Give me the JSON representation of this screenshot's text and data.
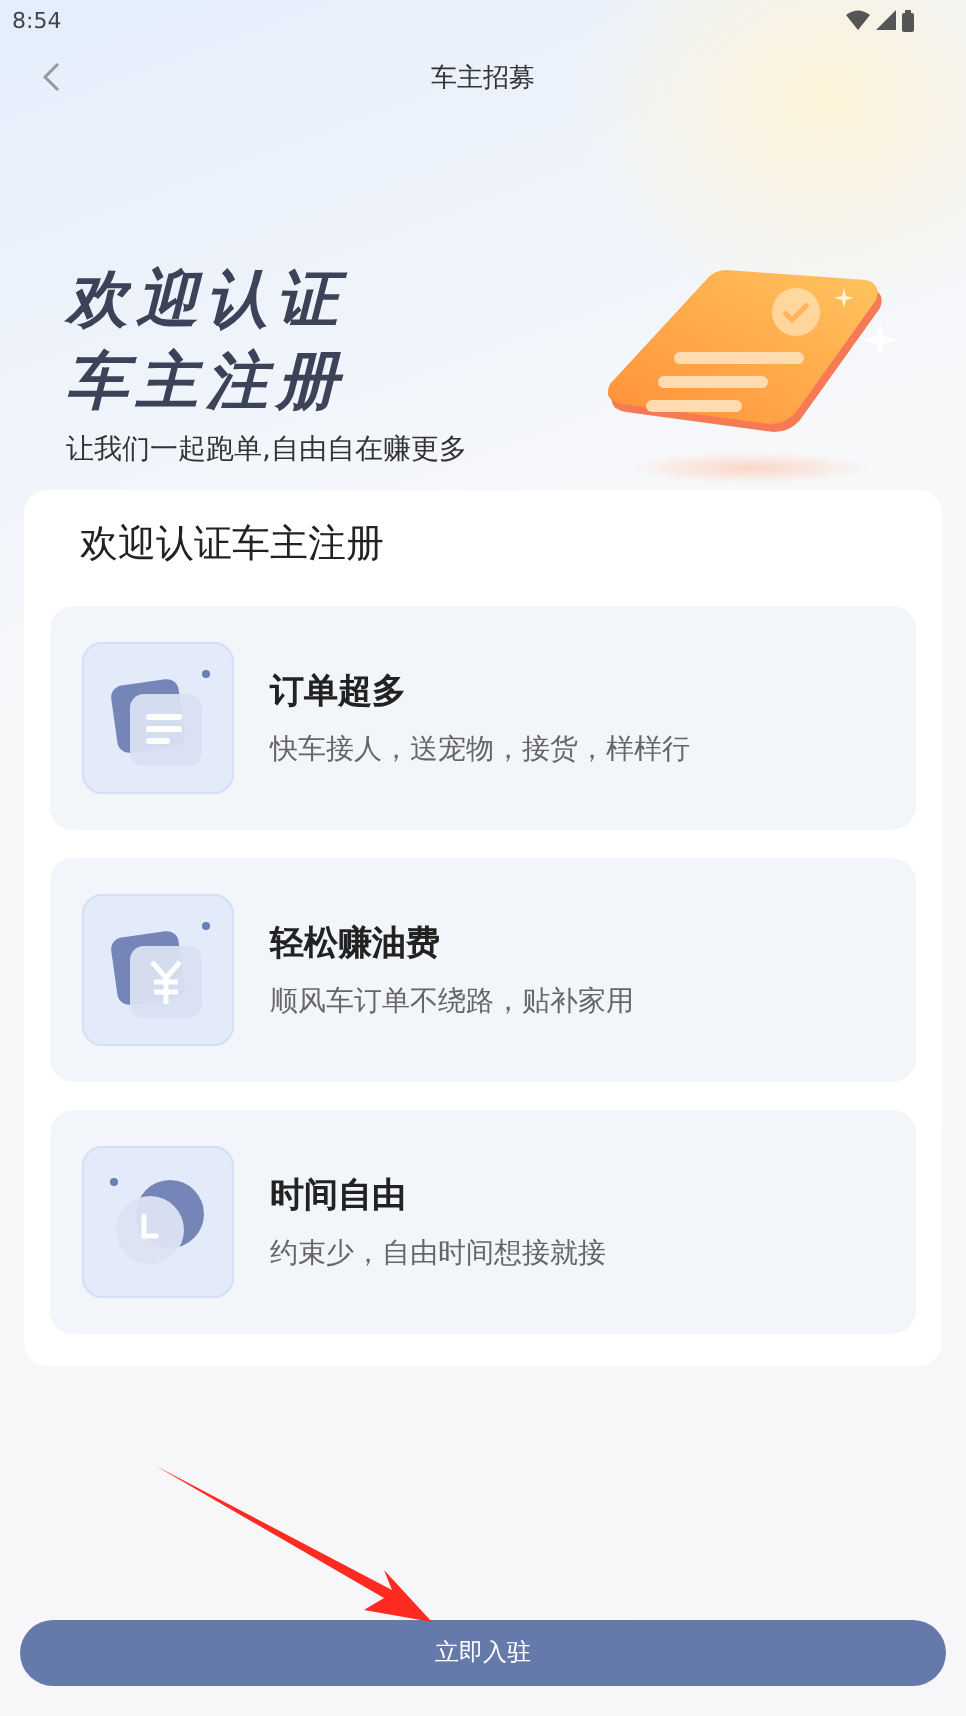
{
  "status_bar": {
    "time": "8:54"
  },
  "nav": {
    "title": "车主招募"
  },
  "hero": {
    "title_lines": [
      "欢迎认证",
      "车主注册"
    ],
    "subtitle": "让我们一起跑单,自由自在赚更多"
  },
  "card": {
    "title": "欢迎认证车主注册",
    "features": [
      {
        "kind": "orders",
        "title": "订单超多",
        "desc": "快车接人，送宠物，接货，样样行"
      },
      {
        "kind": "money",
        "title": "轻松赚油费",
        "desc": "顺风车订单不绕路，贴补家用"
      },
      {
        "kind": "time",
        "title": "时间自由",
        "desc": "约束少，自由时间想接就接"
      }
    ]
  },
  "submit_button": {
    "label": "立即入驻"
  }
}
